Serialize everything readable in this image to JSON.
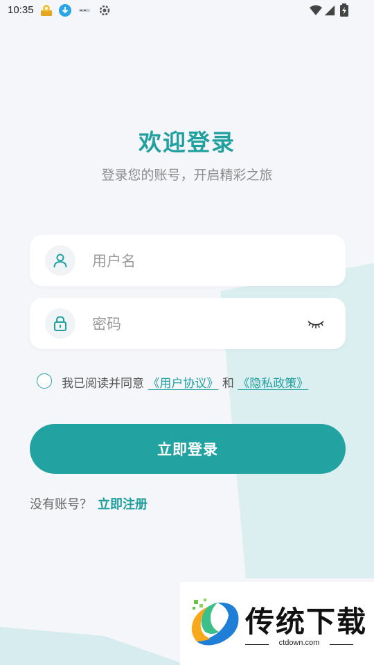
{
  "status_bar": {
    "time": "10:35",
    "notification_icons": [
      "app-badge-icon",
      "download-icon",
      "small-logo-icon",
      "settings-icon"
    ],
    "system_icons": [
      "wifi-icon",
      "signal-icon",
      "battery-icon"
    ]
  },
  "login": {
    "title": "欢迎登录",
    "subtitle": "登录您的账号，开启精彩之旅",
    "username": {
      "placeholder": "用户名",
      "value": "",
      "icon": "user-icon"
    },
    "password": {
      "placeholder": "密码",
      "value": "",
      "icon": "lock-icon",
      "toggle_icon": "eye-closed-icon"
    },
    "agreement": {
      "checked": false,
      "prefix": "我已阅读并同意",
      "user_agreement": "《用户协议》",
      "conjunction": "和",
      "privacy_policy": "《隐私政策》"
    },
    "login_button": "立即登录",
    "register_prompt": "没有账号？",
    "register_link": "立即注册"
  },
  "watermark": {
    "title": "传统下载",
    "subtitle": "ctdown.com"
  },
  "colors": {
    "accent": "#22a0a0",
    "button": "#22a3a2",
    "background": "#f4f6f9",
    "bg_shape": "#d9ecee"
  }
}
